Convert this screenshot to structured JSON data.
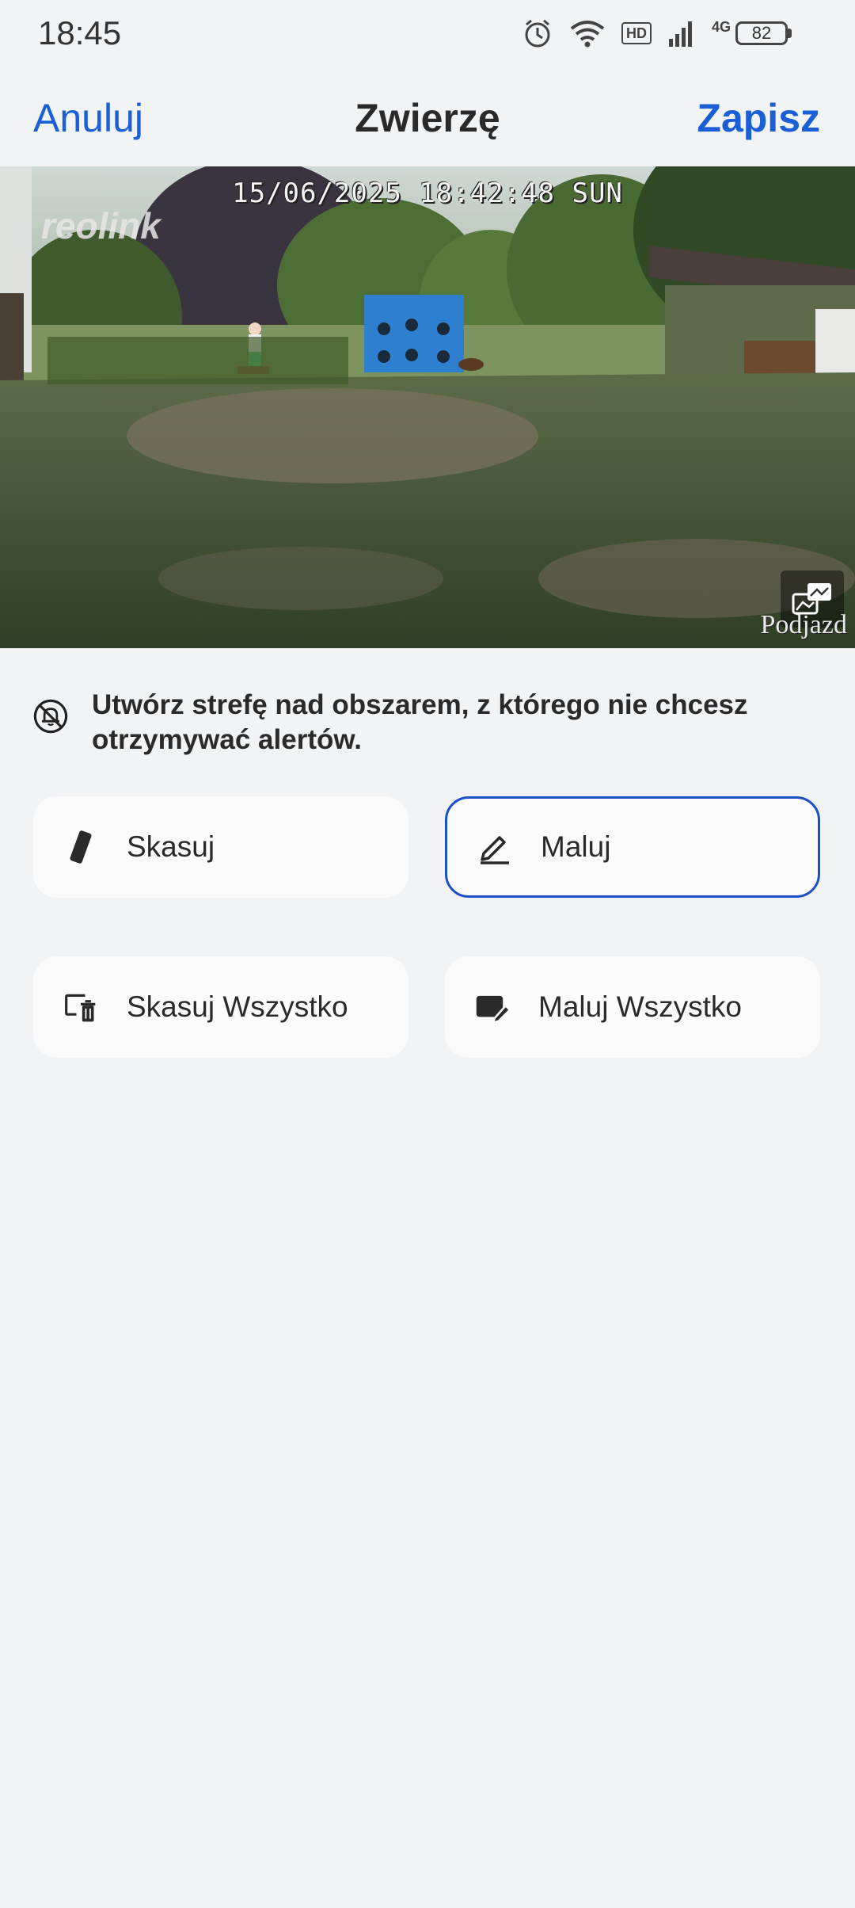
{
  "status_bar": {
    "time": "18:45",
    "hd": "HD",
    "network": "4G",
    "battery": "82",
    "icons": [
      "alarm-icon",
      "wifi-icon",
      "hd-icon",
      "signal-icon",
      "battery-icon"
    ]
  },
  "header": {
    "cancel_label": "Anuluj",
    "title": "Zwierzę",
    "save_label": "Zapisz"
  },
  "camera": {
    "timestamp": "15/06/2025 18:42:48 SUN",
    "logo": "reolink",
    "camera_name": "Podjazd"
  },
  "info": {
    "text": "Utwórz strefę nad obszarem, z którego nie chcesz otrzymywać alertów."
  },
  "tools": {
    "erase": "Skasuj",
    "paint": "Maluj",
    "erase_all": "Skasuj Wszystko",
    "paint_all": "Maluj Wszystko",
    "active": "paint"
  },
  "colors": {
    "accent": "#1a5fd6",
    "background": "#f2f3f5",
    "active_border": "#1a4fc8"
  }
}
